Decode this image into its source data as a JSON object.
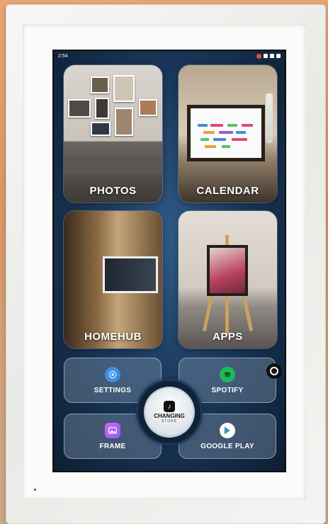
{
  "status_bar": {
    "time": "2:54",
    "notification_count": "1"
  },
  "tiles": {
    "photos": {
      "label": "PHOTOS"
    },
    "calendar": {
      "label": "CALENDAR"
    },
    "homehub": {
      "label": "HOMEHUB"
    },
    "apps": {
      "label": "APPS"
    }
  },
  "shortcuts": {
    "settings": {
      "label": "SETTINGS",
      "icon": "gear-icon",
      "color": "#3b8fe0"
    },
    "spotify": {
      "label": "SPOTIFY",
      "icon": "spotify-icon",
      "color": "#1db954"
    },
    "frame": {
      "label": "FRAME",
      "icon": "image-icon",
      "color": "#b465f0"
    },
    "google_play": {
      "label": "GOOGLE PLAY",
      "icon": "google-play-icon",
      "color": "#ffffff"
    }
  },
  "hub": {
    "badge": "♪",
    "title": "CHANGING",
    "subtitle": "STORE"
  },
  "colors": {
    "screen_bg": "#1b3a5e",
    "frame": "#f2f2f0"
  }
}
